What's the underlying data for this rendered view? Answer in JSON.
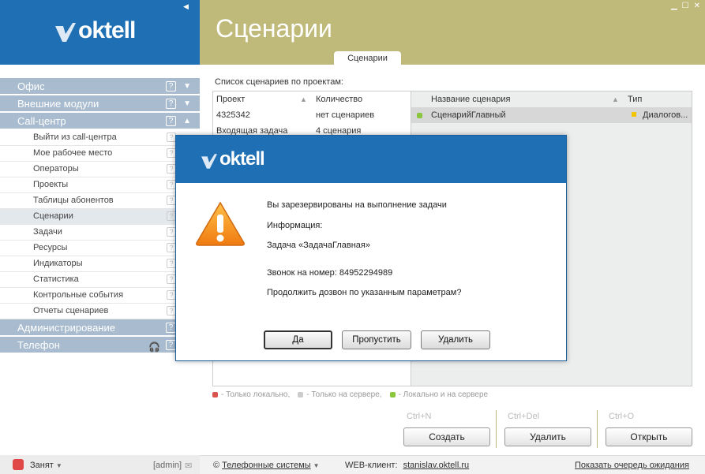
{
  "brand": {
    "logo_text": "oktell"
  },
  "header": {
    "title": "Сценарии",
    "tab": "Сценарии"
  },
  "nav": {
    "sections_top": [
      {
        "label": "Офис",
        "help": "?",
        "arrow": "▼"
      },
      {
        "label": "Внешние модули",
        "help": "?",
        "arrow": "▼"
      },
      {
        "label": "Call-центр",
        "help": "?",
        "arrow": "▲"
      }
    ],
    "items": [
      {
        "label": "Выйти из call-центра",
        "help": "?"
      },
      {
        "label": "Мое рабочее место",
        "help": "?"
      },
      {
        "label": "Операторы",
        "help": "?"
      },
      {
        "label": "Проекты",
        "help": "?"
      },
      {
        "label": "Таблицы абонентов",
        "help": "?"
      },
      {
        "label": "Сценарии",
        "help": "?"
      },
      {
        "label": "Задачи",
        "help": "?"
      },
      {
        "label": "Ресурсы",
        "help": "?"
      },
      {
        "label": "Индикаторы",
        "help": "?"
      },
      {
        "label": "Статистика",
        "help": "?"
      },
      {
        "label": "Контрольные события",
        "help": "?"
      },
      {
        "label": "Отчеты сценариев",
        "help": "?"
      }
    ],
    "sections_bottom": [
      {
        "label": "Администрирование",
        "help": "?"
      },
      {
        "label": "Телефон",
        "help": "?"
      }
    ]
  },
  "scenarios_list": {
    "label": "Список сценариев по проектам:",
    "columns": [
      "Проект",
      "Количество"
    ],
    "rows": [
      {
        "project": "4325342",
        "count": "нет сценариев"
      },
      {
        "project": "Входящая задача",
        "count": "4 сценария"
      }
    ]
  },
  "scenarios_table": {
    "columns": [
      "Название сценария",
      "Тип"
    ],
    "rows": [
      {
        "name": "СценарийГлавный",
        "type": "Диалогов..."
      }
    ]
  },
  "legend": {
    "local": "- Только локально,",
    "server": "- Только на сервере,",
    "both": "- Локально и на сервере"
  },
  "actions": {
    "create": {
      "hotkey": "Ctrl+N",
      "label": "Создать"
    },
    "delete": {
      "hotkey": "Ctrl+Del",
      "label": "Удалить"
    },
    "open": {
      "hotkey": "Ctrl+O",
      "label": "Открыть"
    }
  },
  "dialog": {
    "line1": "Вы зарезервированы на выполнение задачи",
    "line2": "Информация:",
    "line3": "Задача «ЗадачаГлавная»",
    "line4": "Звонок на номер: 84952294989",
    "line5": "Продолжить дозвон по указанным параметрам?",
    "btn_yes": "Да",
    "btn_skip": "Пропустить",
    "btn_delete": "Удалить"
  },
  "statusbar": {
    "status": "Занят",
    "user": "[admin]",
    "copyright": "©",
    "company": "Телефонные системы",
    "web_label": "WEB-клиент:",
    "web_link": "stanislav.oktell.ru",
    "queue_link": "Показать очередь ожидания"
  },
  "colors": {
    "header_blue": "#1e6fb3",
    "header_olive": "#bfb97a",
    "nav_blue": "#a9bccf"
  }
}
